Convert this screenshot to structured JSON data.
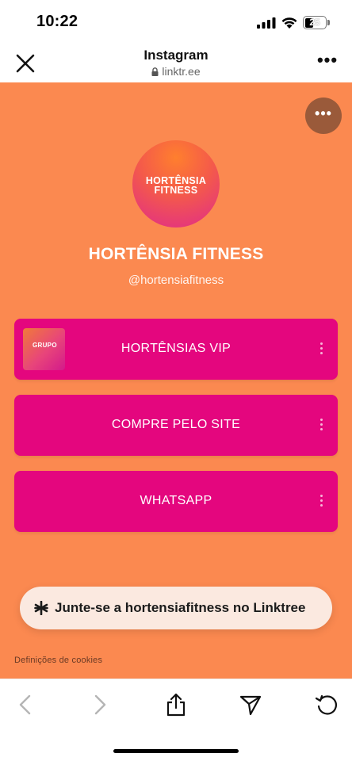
{
  "status_bar": {
    "time": "10:22",
    "battery": "25"
  },
  "browser": {
    "title": "Instagram",
    "url": "linktr.ee"
  },
  "profile": {
    "avatar_line1": "HORTÊNSIA",
    "avatar_line2": "FITNESS",
    "name": "HORTÊNSIA FITNESS",
    "handle": "@hortensiafitness"
  },
  "links": [
    {
      "label": "HORTÊNSIAS VIP",
      "thumb_text": "GRUPO"
    },
    {
      "label": "COMPRE PELO SITE"
    },
    {
      "label": "WHATSAPP"
    }
  ],
  "join_cta": "Junte-se a hortensiafitness no Linktree",
  "cookies_label": "Definições de cookies",
  "colors": {
    "background": "#fb8950",
    "link_button": "#e4067e",
    "pill": "#fbe9e0"
  }
}
